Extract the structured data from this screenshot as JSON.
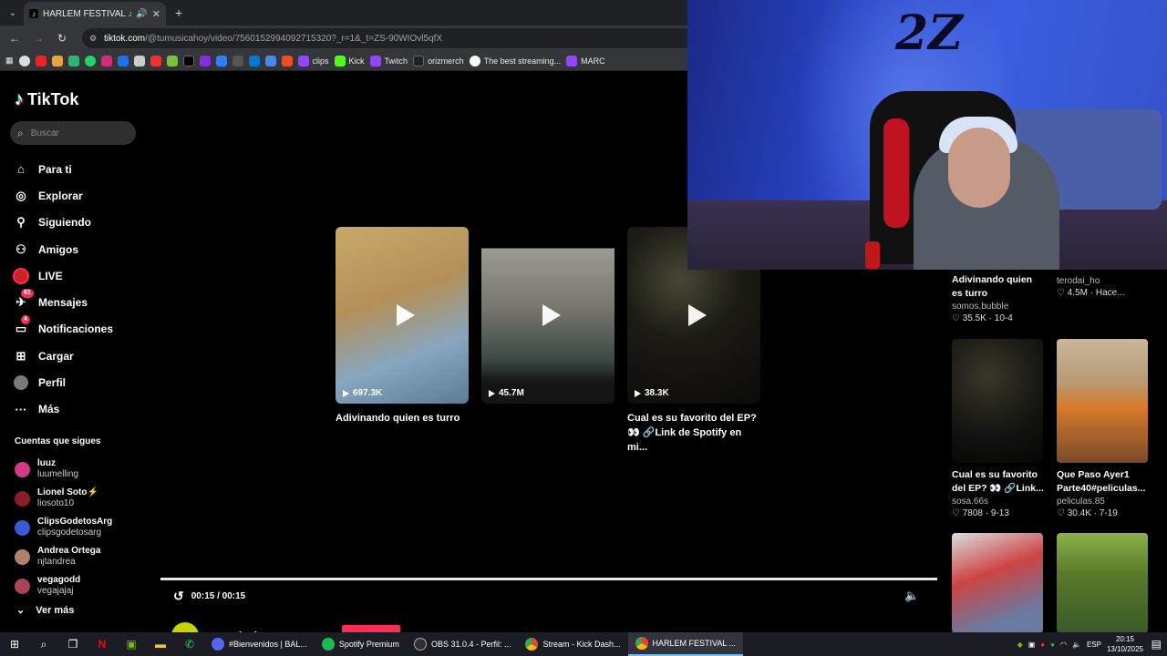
{
  "browser": {
    "tab_title": "HARLEM FESTIVAL ♫ ♫",
    "url_host": "tiktok.com",
    "url_path": "/@tumusicahoy/video/7560152994092715320?_r=1&_t=ZS-90WIOvl5qfX",
    "bookmarks": [
      "clips",
      "Kick",
      "Twitch",
      "orizmerch",
      "The best streaming...",
      "MARC"
    ]
  },
  "tiktok": {
    "logo": "TikTok",
    "search_placeholder": "Buscar",
    "nav": [
      {
        "label": "Para ti",
        "icon": "home-icon"
      },
      {
        "label": "Explorar",
        "icon": "compass-icon"
      },
      {
        "label": "Siguiendo",
        "icon": "following-icon"
      },
      {
        "label": "Amigos",
        "icon": "friends-icon"
      },
      {
        "label": "LIVE",
        "icon": "live-icon"
      },
      {
        "label": "Mensajes",
        "icon": "messages-icon",
        "badge": "61"
      },
      {
        "label": "Notificaciones",
        "icon": "notifications-icon",
        "badge": "4"
      },
      {
        "label": "Cargar",
        "icon": "upload-icon"
      },
      {
        "label": "Perfil",
        "icon": "profile-icon"
      },
      {
        "label": "Más",
        "icon": "more-icon"
      }
    ],
    "following_title": "Cuentas que sigues",
    "following": [
      {
        "name": "luuz",
        "user": "luumelling",
        "color": "#d43a8a"
      },
      {
        "name": "Lionel Soto⚡",
        "user": "liosoto10",
        "color": "#8a1d2a"
      },
      {
        "name": "ClipsGodetosArg",
        "user": "clipsgodetosarg",
        "color": "#3a5ad4"
      },
      {
        "name": "Andrea Ortega",
        "user": "njtandrea",
        "color": "#b0806a"
      },
      {
        "name": "vegagodd",
        "user": "vegajajaj",
        "color": "#aa4455"
      }
    ],
    "more_label": "Ver más"
  },
  "main": {
    "cards": [
      {
        "views": "697.3K",
        "title": "Adivinando quien es turro"
      },
      {
        "views": "45.7M",
        "title": ""
      },
      {
        "views": "38.3K",
        "title": "Cual es su favorito del EP? 👀 🔗Link de Spotify en mi..."
      }
    ],
    "time": "00:15 / 00:15",
    "progress_fraction": 1.0,
    "author": "tumusicahoy"
  },
  "recommendations": [
    {
      "title": "Adivinando quien es turro",
      "user": "somos.bubble",
      "likes": "35.5K",
      "date": "10-4"
    },
    {
      "title": "",
      "user": "terodai_ho",
      "likes": "4.5M",
      "date": "Hace..."
    },
    {
      "title": "Cual es su favorito del EP? 👀 🔗Link...",
      "user": "sosa.66s",
      "likes": "7808",
      "date": "9-13"
    },
    {
      "title": "Que Paso Ayer1 Parte40#peliculas...",
      "user": "peliculas.85",
      "likes": "30.4K",
      "date": "7-19"
    }
  ],
  "webcam": {
    "wall_logo": "2Z"
  },
  "taskbar": {
    "apps": [
      "#Bienvenidos | BAL...",
      "Spotify Premium",
      "OBS 31.0.4 - Perfil: ...",
      "Stream - Kick Dash...",
      "HARLEM FESTIVAL ..."
    ],
    "lang": "ESP",
    "time": "20:15",
    "date": "13/10/2025"
  }
}
